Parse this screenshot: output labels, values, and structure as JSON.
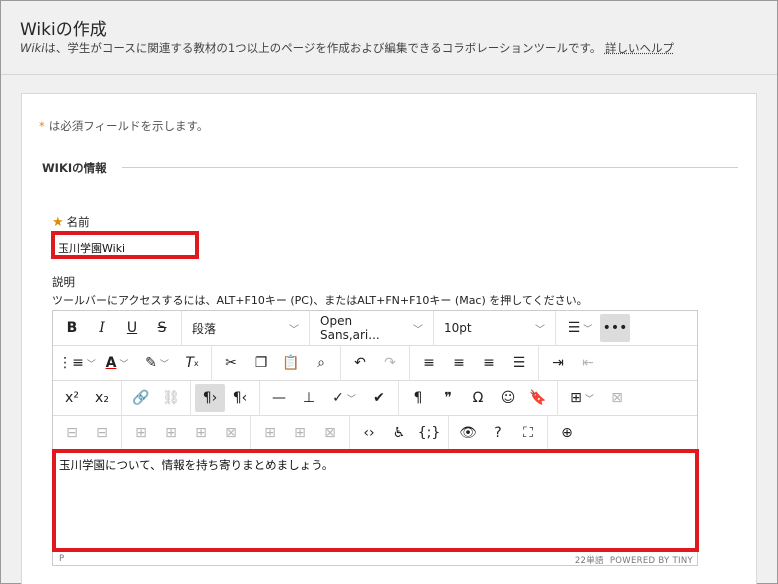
{
  "header": {
    "title": "Wikiの作成",
    "desc_em": "Wiki",
    "desc_rest": "は、学生がコースに関連する教材の1つ以上のページを作成および編集できるコラボレーションツールです。",
    "help_link": "詳しいヘルプ"
  },
  "form": {
    "required_note": "は必須フィールドを示します。",
    "section_title": "WIKIの情報",
    "name_label": "名前",
    "name_value": "玉川学園Wiki",
    "desc_label": "説明",
    "desc_hint": "ツールバーにアクセスするには、ALT+F10キー (PC)、またはALT+FN+F10キー (Mac) を押してください。"
  },
  "editor": {
    "block_format": "段落",
    "font_family": "Open Sans,ari...",
    "font_size": "10pt",
    "content": "玉川学園について、情報を持ち寄りまとめましょう。",
    "status_path": "P",
    "word_count": "22単語",
    "powered_by": "POWERED BY TINY"
  },
  "colors": {
    "required": "#e08a00",
    "highlight_border": "#e0191e"
  }
}
